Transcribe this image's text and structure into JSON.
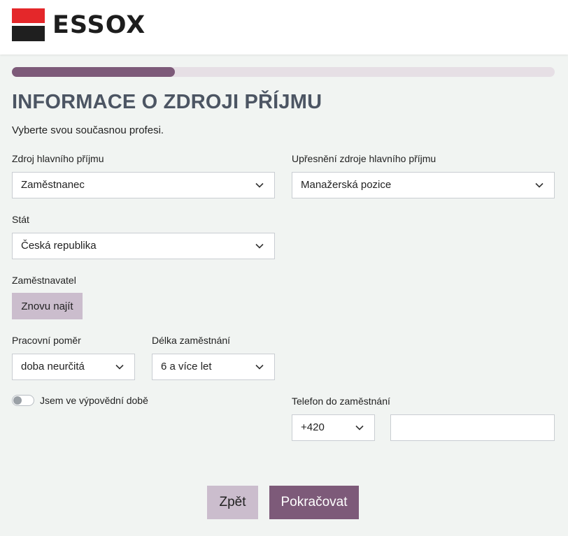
{
  "brand": {
    "name": "ESSOX",
    "colors": {
      "red": "#e4272a",
      "dark": "#1f1f1f",
      "accent": "#7d5a79",
      "accent_light": "#cbbdcd"
    }
  },
  "progress": {
    "value": 0.3
  },
  "page": {
    "title": "INFORMACE O ZDROJI PŘÍJMU",
    "subtitle": "Vyberte svou současnou profesi."
  },
  "form": {
    "main_income": {
      "label": "Zdroj hlavního příjmu",
      "value": "Zaměstnanec"
    },
    "income_detail": {
      "label": "Upřesnění zdroje hlavního příjmu",
      "value": "Manažerská pozice"
    },
    "country": {
      "label": "Stát",
      "value": "Česká republika"
    },
    "employer": {
      "label": "Zaměstnavatel",
      "button_label": "Znovu najít"
    },
    "employment_type": {
      "label": "Pracovní poměr",
      "value": "doba neurčitá"
    },
    "employment_length": {
      "label": "Délka zaměstnání",
      "value": "6 a více let"
    },
    "notice_period": {
      "label": "Jsem ve výpovědní době",
      "checked": false
    },
    "work_phone": {
      "label": "Telefon do zaměstnání",
      "prefix": "+420",
      "value": ""
    }
  },
  "actions": {
    "back_label": "Zpět",
    "next_label": "Pokračovat"
  },
  "icons": {
    "dropdown": "chevron-down-icon"
  }
}
